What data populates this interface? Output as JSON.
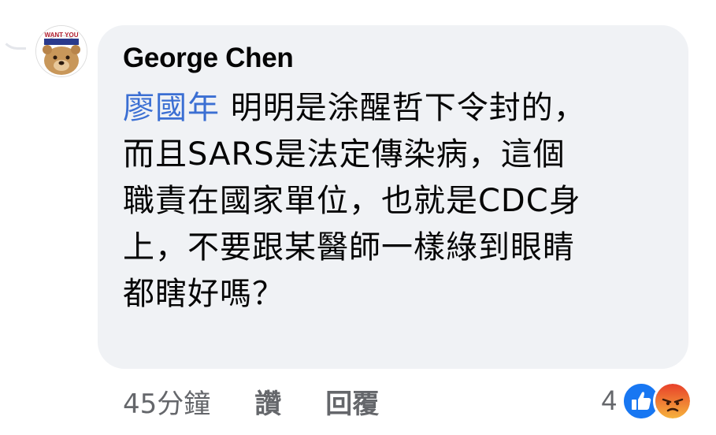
{
  "comment": {
    "author": "George Chen",
    "avatar_caption": "WANT YOU",
    "mention": "廖國年",
    "lines": [
      " 明明是涂醒哲下令封的，",
      "而且SARS是法定傳染病，這個",
      "職責在國家單位，也就是CDC身",
      "上，不要跟某醫師一樣綠到眼睛",
      "都瞎好嗎？"
    ]
  },
  "actions": {
    "time": "45分鐘",
    "like_label": "讚",
    "reply_label": "回覆"
  },
  "reactions": {
    "count": "4",
    "icons": [
      "like-icon",
      "angry-icon"
    ],
    "like_color": "#1877f2",
    "angry_color": "#f0623a"
  }
}
